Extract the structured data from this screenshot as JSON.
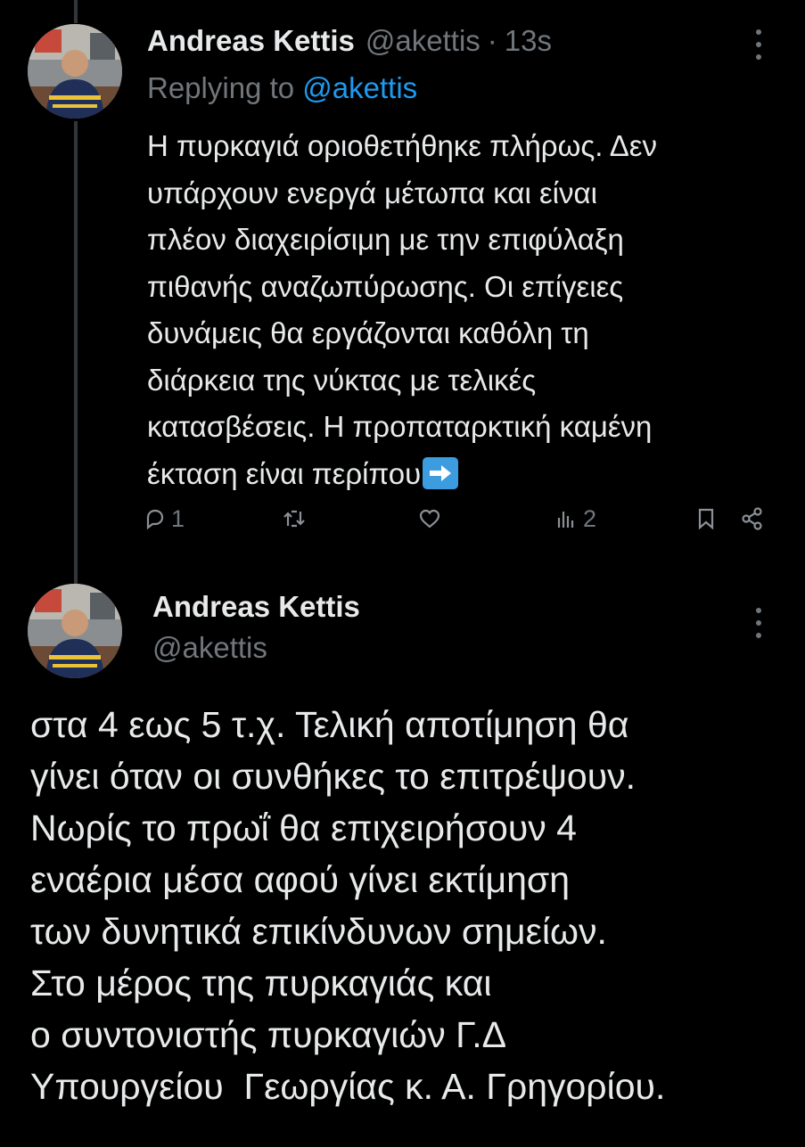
{
  "tweet1": {
    "author_name": "Andreas Kettis",
    "handle": "@akettis",
    "separator": "·",
    "time": "13s",
    "replying_prefix": "Replying to",
    "replying_to": "@akettis",
    "body_lines": [
      "Η πυρκαγιά οριοθετήθηκε πλήρως. Δεν",
      "υπάρχουν ενεργά μέτωπα και είναι",
      "πλέον διαχειρίσιμη με την επιφύλαξη",
      "πιθανής αναζωπύρωσης. Οι επίγειες",
      "δυνάμεις θα εργάζονται καθόλη τη",
      "διάρκεια της νύκτας με τελικές",
      "κατασβέσεις. Η προπαταρκτική καμένη",
      "έκταση είναι περίπου"
    ],
    "trailing_emoji": "right-arrow-emoji",
    "actions": {
      "reply_count": "1",
      "retweet_count": "",
      "like_count": "",
      "views_count": "2"
    }
  },
  "tweet2": {
    "author_name": "Andreas Kettis",
    "handle": "@akettis",
    "body_lines": [
      "στα 4 εως 5 τ.χ. Τελική αποτίμηση θα",
      "γίνει όταν οι συνθήκες το επιτρέψουν.",
      "Νωρίς το πρωΐ θα επιχειρήσουν 4",
      "εναέρια μέσα αφού γίνει εκτίμηση",
      "των δυνητικά επικίνδυνων σημείων.",
      "Στο μέρος της πυρκαγιάς και",
      "ο συντονιστής πυρκαγιών Γ.Δ",
      "Υπουργείου  Γεωργίας κ. Α. Γρηγορίου."
    ]
  },
  "colors": {
    "background": "#000000",
    "text": "#e7e9ea",
    "secondary": "#71767b",
    "accent": "#1d9bf0"
  }
}
